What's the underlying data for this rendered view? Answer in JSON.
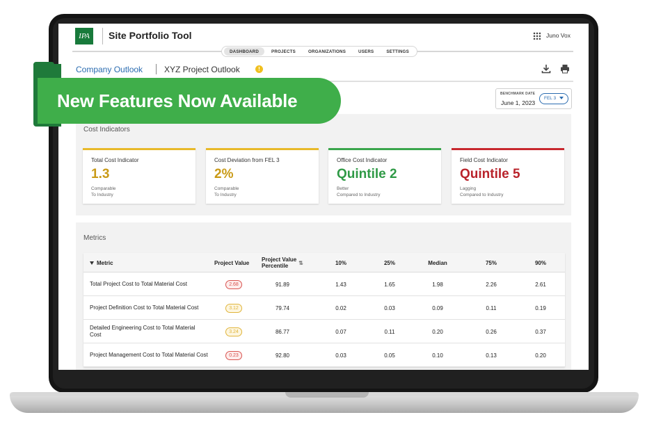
{
  "app": {
    "logo_text": "IPA",
    "title": "Site Portfolio Tool",
    "user_name": "Juno Vox"
  },
  "nav": {
    "tabs": [
      {
        "label": "DASHBOARD",
        "active": true
      },
      {
        "label": "PROJECTS",
        "active": false
      },
      {
        "label": "ORGANIZATIONS",
        "active": false
      },
      {
        "label": "USERS",
        "active": false
      },
      {
        "label": "SETTINGS",
        "active": false
      }
    ]
  },
  "breadcrumb": {
    "company": "Company Outlook",
    "project": "XYZ Project Outlook",
    "icon": "warning-icon"
  },
  "toolbar": {
    "download_icon": "download-icon",
    "print_icon": "print-icon"
  },
  "benchmark": {
    "label": "BENCHMARK DATE",
    "date": "June 1, 2023",
    "fel_value": "FEL 3"
  },
  "banner": {
    "text": "New Features Now Available",
    "color": "#3fae4a"
  },
  "cost_indicators": {
    "title": "Cost Indicators",
    "cards": [
      {
        "label": "Total Cost Indicator",
        "value": "1.3",
        "note_line1": "Comparable",
        "note_line2": "To Industry",
        "color": "#e8b92a",
        "value_color": "#c99a16"
      },
      {
        "label": "Cost Deviation from FEL 3",
        "value": "2%",
        "note_line1": "Comparable",
        "note_line2": "To Industry",
        "color": "#e8b92a",
        "value_color": "#c99a16"
      },
      {
        "label": "Office Cost Indicator",
        "value": "Quintile 2",
        "note_line1": "Better",
        "note_line2": "Compared to Industry",
        "color": "#3aa64c",
        "value_color": "#2f9a46"
      },
      {
        "label": "Field Cost Indicator",
        "value": "Quintile 5",
        "note_line1": "Lagging",
        "note_line2": "Compared to Industry",
        "color": "#c8282e",
        "value_color": "#b9232b"
      }
    ]
  },
  "metrics": {
    "title": "Metrics",
    "columns": {
      "metric": "Metric",
      "project_value": "Project Value",
      "percentile_line1": "Project Value",
      "percentile_line2": "Percentile",
      "p10": "10%",
      "p25": "25%",
      "median": "Median",
      "p75": "75%",
      "p90": "90%"
    },
    "rows": [
      {
        "metric": "Total Project Cost to Total Material Cost",
        "project_value": "2.68",
        "status": "red",
        "percentile": "91.89",
        "p10": "1.43",
        "p25": "1.65",
        "median": "1.98",
        "p75": "2.26",
        "p90": "2.61"
      },
      {
        "metric": "Project Definition Cost to Total Material Cost",
        "project_value": "3.12",
        "status": "yellow",
        "percentile": "79.74",
        "p10": "0.02",
        "p25": "0.03",
        "median": "0.09",
        "p75": "0.11",
        "p90": "0.19"
      },
      {
        "metric": "Detailed Engineering Cost to Total Material Cost",
        "project_value": "3.24",
        "status": "yellow",
        "percentile": "86.77",
        "p10": "0.07",
        "p25": "0.11",
        "median": "0.20",
        "p75": "0.26",
        "p90": "0.37"
      },
      {
        "metric": "Project Management Cost to Total Material Cost",
        "project_value": "0.23",
        "status": "red",
        "percentile": "92.80",
        "p10": "0.03",
        "p25": "0.05",
        "median": "0.10",
        "p75": "0.13",
        "p90": "0.20"
      }
    ],
    "status_colors": {
      "red": "#d9534f",
      "yellow": "#e0b43a"
    }
  }
}
